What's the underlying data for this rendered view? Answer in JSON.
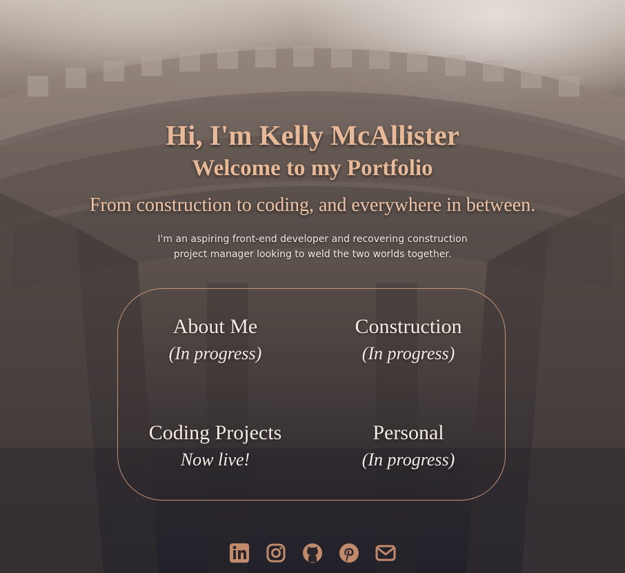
{
  "header": {
    "greeting": "Hi, I'm Kelly McAllister",
    "welcome": "Welcome to my Portfolio",
    "tagline": "From construction to coding, and everywhere in between.",
    "intro_line1": "I'm an aspiring front-end developer and recovering construction",
    "intro_line2": "project manager looking to weld the two worlds together."
  },
  "nav": [
    {
      "label": "About Me",
      "status": "(In progress)"
    },
    {
      "label": "Construction",
      "status": "(In progress)"
    },
    {
      "label": "Coding Projects",
      "status": "Now live!"
    },
    {
      "label": "Personal",
      "status": "(In progress)"
    }
  ],
  "social": {
    "icons": [
      "linkedin-icon",
      "instagram-icon",
      "github-icon",
      "pinterest-icon",
      "email-icon"
    ],
    "color": "#c28a6c"
  },
  "colors": {
    "accent": "#e8b999",
    "card_border": "#c39477",
    "text_light": "#f4ece5"
  }
}
